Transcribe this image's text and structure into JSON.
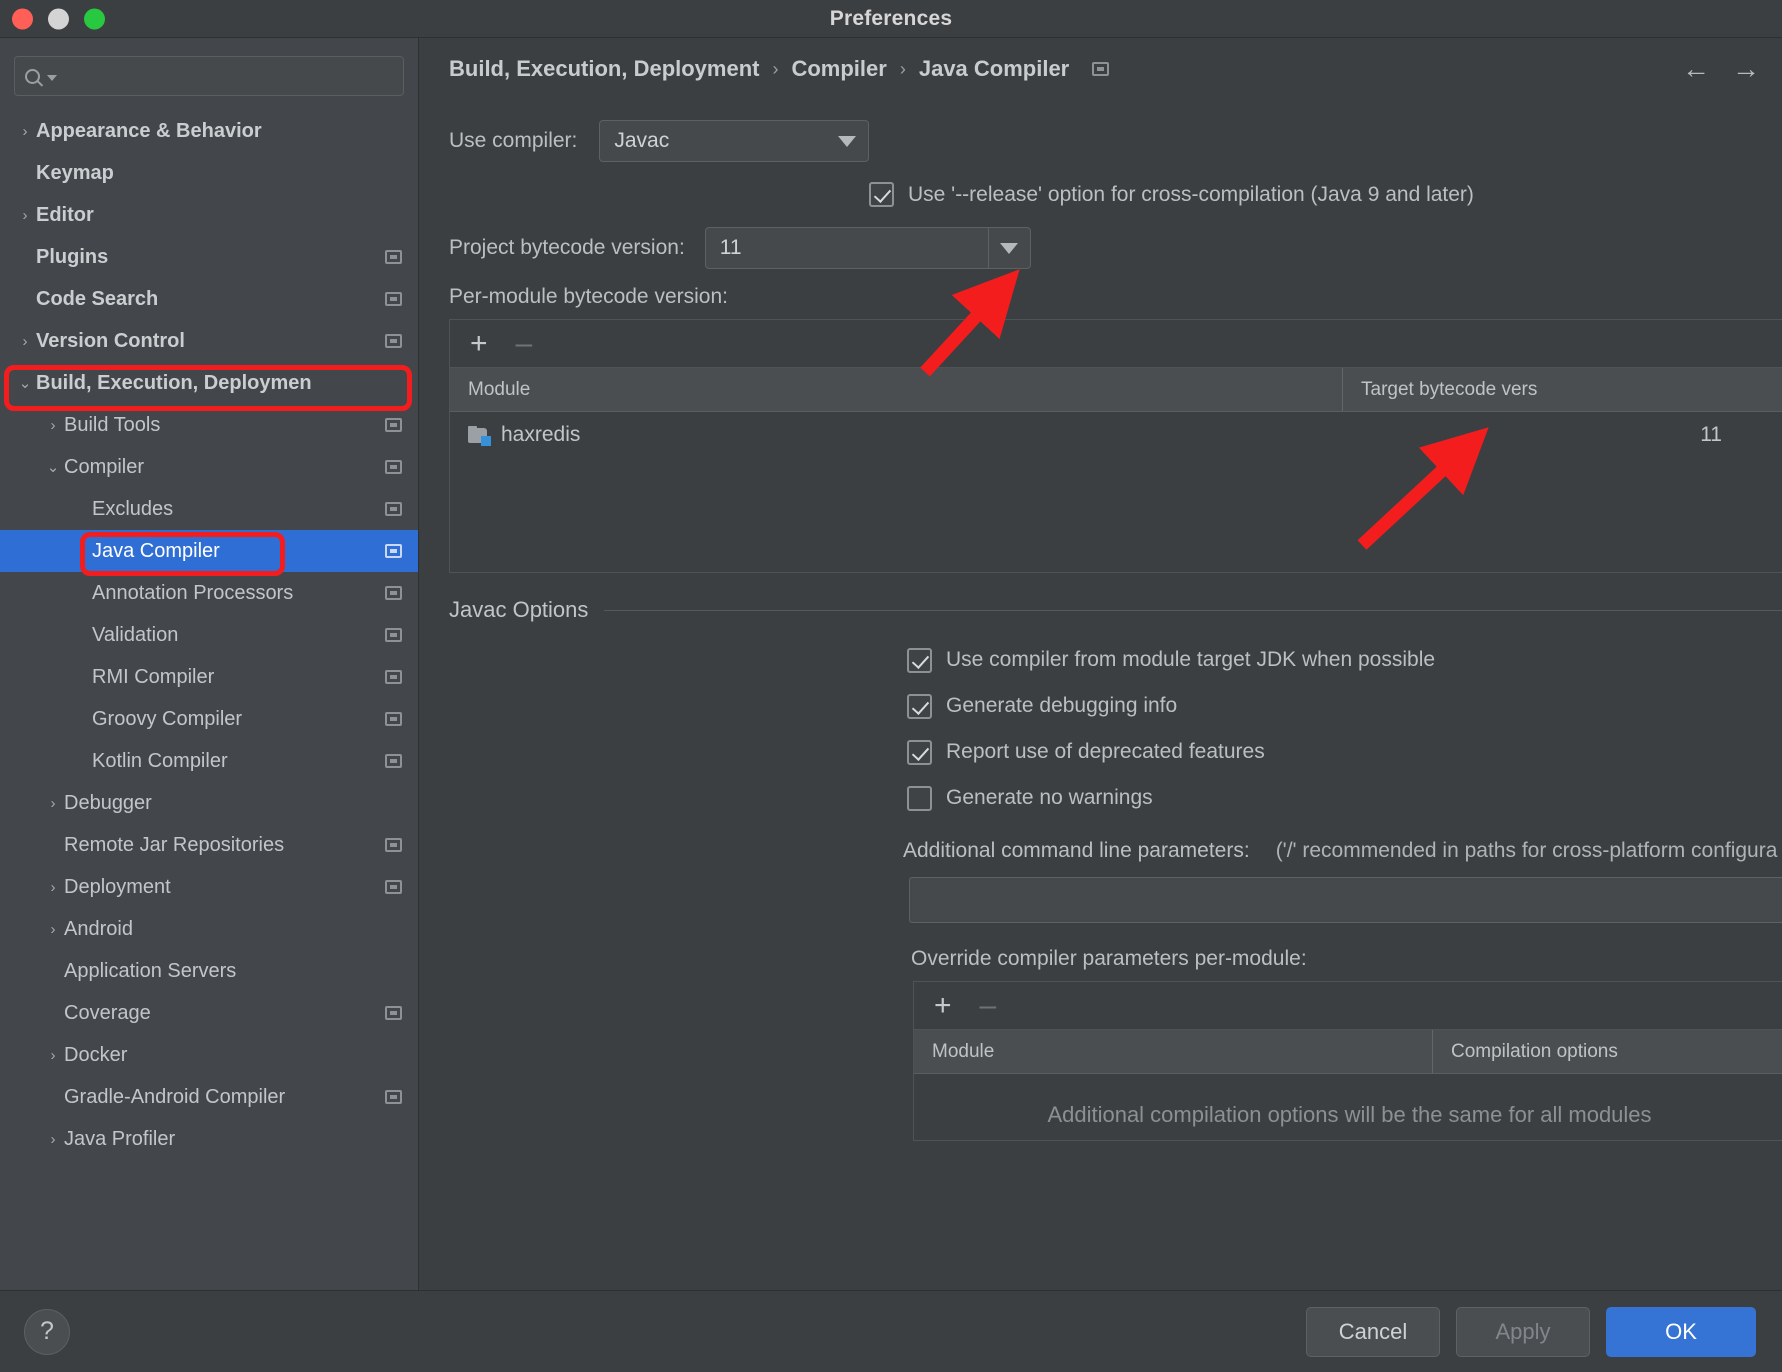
{
  "window": {
    "title": "Preferences",
    "traffic_lights": [
      "close",
      "minimize",
      "zoom"
    ]
  },
  "sidebar": {
    "search": {
      "value": "",
      "placeholder": ""
    },
    "items": [
      {
        "label": "Appearance & Behavior",
        "level": 0,
        "arrow": "›",
        "bold": true,
        "cfg": false,
        "selected": false
      },
      {
        "label": "Keymap",
        "level": 0,
        "arrow": "",
        "bold": true,
        "cfg": false,
        "selected": false
      },
      {
        "label": "Editor",
        "level": 0,
        "arrow": "›",
        "bold": true,
        "cfg": false,
        "selected": false
      },
      {
        "label": "Plugins",
        "level": 0,
        "arrow": "",
        "bold": true,
        "cfg": true,
        "selected": false
      },
      {
        "label": "Code Search",
        "level": 0,
        "arrow": "",
        "bold": true,
        "cfg": true,
        "selected": false
      },
      {
        "label": "Version Control",
        "level": 0,
        "arrow": "›",
        "bold": true,
        "cfg": true,
        "selected": false
      },
      {
        "label": "Build, Execution, Deploymen",
        "level": 0,
        "arrow": "⌄",
        "bold": true,
        "cfg": false,
        "selected": false
      },
      {
        "label": "Build Tools",
        "level": 1,
        "arrow": "›",
        "bold": false,
        "cfg": true,
        "selected": false
      },
      {
        "label": "Compiler",
        "level": 1,
        "arrow": "⌄",
        "bold": false,
        "cfg": true,
        "selected": false
      },
      {
        "label": "Excludes",
        "level": 2,
        "arrow": "",
        "bold": false,
        "cfg": true,
        "selected": false
      },
      {
        "label": "Java Compiler",
        "level": 2,
        "arrow": "",
        "bold": false,
        "cfg": true,
        "selected": true
      },
      {
        "label": "Annotation Processors",
        "level": 2,
        "arrow": "",
        "bold": false,
        "cfg": true,
        "selected": false
      },
      {
        "label": "Validation",
        "level": 2,
        "arrow": "",
        "bold": false,
        "cfg": true,
        "selected": false
      },
      {
        "label": "RMI Compiler",
        "level": 2,
        "arrow": "",
        "bold": false,
        "cfg": true,
        "selected": false
      },
      {
        "label": "Groovy Compiler",
        "level": 2,
        "arrow": "",
        "bold": false,
        "cfg": true,
        "selected": false
      },
      {
        "label": "Kotlin Compiler",
        "level": 2,
        "arrow": "",
        "bold": false,
        "cfg": true,
        "selected": false
      },
      {
        "label": "Debugger",
        "level": 1,
        "arrow": "›",
        "bold": false,
        "cfg": false,
        "selected": false
      },
      {
        "label": "Remote Jar Repositories",
        "level": 1,
        "arrow": "",
        "bold": false,
        "cfg": true,
        "selected": false
      },
      {
        "label": "Deployment",
        "level": 1,
        "arrow": "›",
        "bold": false,
        "cfg": true,
        "selected": false
      },
      {
        "label": "Android",
        "level": 1,
        "arrow": "›",
        "bold": false,
        "cfg": false,
        "selected": false
      },
      {
        "label": "Application Servers",
        "level": 1,
        "arrow": "",
        "bold": false,
        "cfg": false,
        "selected": false
      },
      {
        "label": "Coverage",
        "level": 1,
        "arrow": "",
        "bold": false,
        "cfg": true,
        "selected": false
      },
      {
        "label": "Docker",
        "level": 1,
        "arrow": "›",
        "bold": false,
        "cfg": false,
        "selected": false
      },
      {
        "label": "Gradle-Android Compiler",
        "level": 1,
        "arrow": "",
        "bold": false,
        "cfg": true,
        "selected": false
      },
      {
        "label": "Java Profiler",
        "level": 1,
        "arrow": "›",
        "bold": false,
        "cfg": false,
        "selected": false
      }
    ]
  },
  "breadcrumb": {
    "parts": [
      "Build, Execution, Deployment",
      "Compiler",
      "Java Compiler"
    ],
    "separator": "›",
    "back_arrow": "←",
    "forward_arrow": "→"
  },
  "main": {
    "use_compiler_label": "Use compiler:",
    "use_compiler_value": "Javac",
    "release_option_label": "Use '--release' option for cross-compilation (Java 9 and later)",
    "release_option_checked": true,
    "project_bytecode_label": "Project bytecode version:",
    "project_bytecode_value": "11",
    "per_module_label": "Per-module bytecode version:",
    "bytecode_table": {
      "add_label": "+",
      "remove_label": "–",
      "columns": [
        "Module",
        "Target bytecode vers"
      ],
      "rows": [
        {
          "module": "haxredis",
          "target": "11"
        }
      ]
    },
    "javac_options_title": "Javac Options",
    "javac_checkboxes": [
      {
        "label": "Use compiler from module target JDK when possible",
        "checked": true
      },
      {
        "label": "Generate debugging info",
        "checked": true
      },
      {
        "label": "Report use of deprecated features",
        "checked": true
      },
      {
        "label": "Generate no warnings",
        "checked": false
      }
    ],
    "additional_params_label": "Additional command line parameters:",
    "additional_params_hint": "('/' recommended in paths for cross-platform configura",
    "additional_params_value": "",
    "override_label": "Override compiler parameters per-module:",
    "override_table": {
      "add_label": "+",
      "remove_label": "–",
      "columns": [
        "Module",
        "Compilation options"
      ],
      "empty_message": "Additional compilation options will be the same for all modules"
    }
  },
  "footer": {
    "help_label": "?",
    "cancel_label": "Cancel",
    "apply_label": "Apply",
    "ok_label": "OK"
  },
  "annotations": {
    "accent_color": "#f41d1d",
    "boxes": [
      "build-execution-deployment-tree-item",
      "java-compiler-tree-item"
    ],
    "arrows": [
      "project-bytecode-dropdown-arrow",
      "target-bytecode-value-arrow"
    ]
  }
}
